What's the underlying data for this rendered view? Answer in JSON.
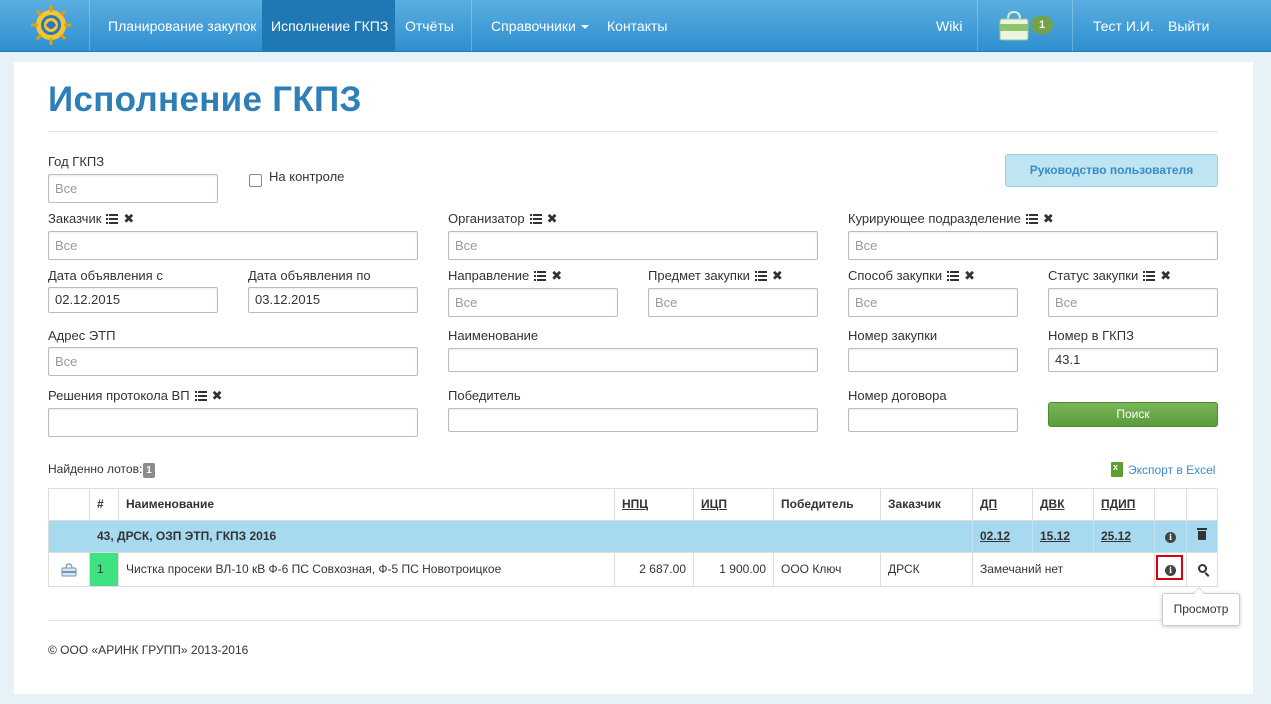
{
  "nav": {
    "items": [
      "Планирование закупок",
      "Исполнение ГКПЗ",
      "Отчёты",
      "Справочники",
      "Контакты"
    ],
    "wiki": "Wiki",
    "cart_count": "1",
    "user": "Тест И.И.",
    "logout": "Выйти"
  },
  "page": {
    "title": "Исполнение ГКПЗ"
  },
  "filters": {
    "year_label": "Год ГКПЗ",
    "year_value": "Все",
    "on_control_label": "На контроле",
    "guide_button": "Руководство пользователя",
    "customer_label": "Заказчик",
    "customer_value": "Все",
    "organizer_label": "Организатор",
    "organizer_value": "Все",
    "curating_label": "Курирующее подразделение",
    "curating_value": "Все",
    "date_from_label": "Дата объявления с",
    "date_from_value": "02.12.2015",
    "date_to_label": "Дата объявления по",
    "date_to_value": "03.12.2015",
    "direction_label": "Направление",
    "direction_value": "Все",
    "subject_label": "Предмет закупки",
    "subject_value": "Все",
    "method_label": "Способ закупки",
    "method_value": "Все",
    "status_label": "Статус закупки",
    "status_value": "Все",
    "etp_label": "Адрес ЭТП",
    "etp_value": "Все",
    "name_label": "Наименование",
    "name_value": "",
    "purchase_num_label": "Номер закупки",
    "purchase_num_value": "",
    "gkpz_num_label": "Номер в ГКПЗ",
    "gkpz_num_value": "43.1",
    "protocol_label": "Решения протокола ВП",
    "protocol_value": "",
    "winner_label": "Победитель",
    "winner_value": "",
    "contract_label": "Номер договора",
    "contract_value": "",
    "search_button": "Поиск"
  },
  "results": {
    "found_label": "Найденно лотов:",
    "found_count": "1",
    "export_label": "Экспорт в Excel"
  },
  "table": {
    "headers": {
      "num": "#",
      "name": "Наименование",
      "npc": "НПЦ",
      "icp": "ИЦП",
      "winner": "Победитель",
      "customer": "Заказчик",
      "dp": "ДП",
      "dvk": "ДВК",
      "pdip": "ПДИП"
    },
    "group": {
      "title": "43, ДРСК, ОЗП ЭТП, ГКПЗ 2016",
      "dp": "02.12",
      "dvk": "15.12",
      "pdip": "25.12"
    },
    "row": {
      "num": "1",
      "name": "Чистка просеки ВЛ-10 кВ Ф-6 ПС Совхозная, Ф-5 ПС Новотроицкое",
      "npc": "2 687.00",
      "icp": "1 900.00",
      "winner": "ООО Ключ",
      "customer": "ДРСК",
      "remarks": "Замечаний нет"
    }
  },
  "tooltip": "Просмотр",
  "footer": "© ООО «АРИНК ГРУПП» 2013-2016",
  "colors": {
    "navbar": "#3b9ad8",
    "nav_active": "#1f78b4",
    "title": "#2e7fb8",
    "group_row": "#a8daef",
    "row_number": "#3fe281",
    "search_button": "#6aa84a",
    "highlight_border": "#d9000d"
  }
}
